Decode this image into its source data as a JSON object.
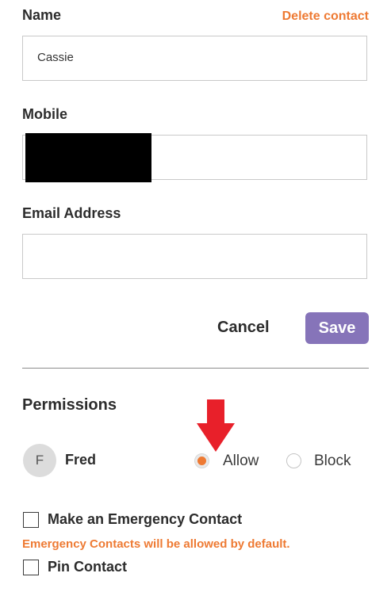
{
  "form": {
    "name_label": "Name",
    "delete_link": "Delete contact",
    "name_value": "Cassie",
    "mobile_label": "Mobile",
    "mobile_value": "",
    "email_label": "Email Address",
    "email_value": ""
  },
  "actions": {
    "cancel_label": "Cancel",
    "save_label": "Save"
  },
  "permissions": {
    "heading": "Permissions",
    "user": {
      "avatar_initial": "F",
      "name": "Fred",
      "selected": "Allow"
    },
    "allow_label": "Allow",
    "block_label": "Block"
  },
  "options": {
    "emergency_label": "Make an Emergency Contact",
    "emergency_note": "Emergency Contacts will be allowed by default.",
    "pin_label": "Pin Contact"
  },
  "colors": {
    "accent_orange": "#ee7a33",
    "save_purple": "#8674b9",
    "annotation_arrow": "#e8202a"
  }
}
